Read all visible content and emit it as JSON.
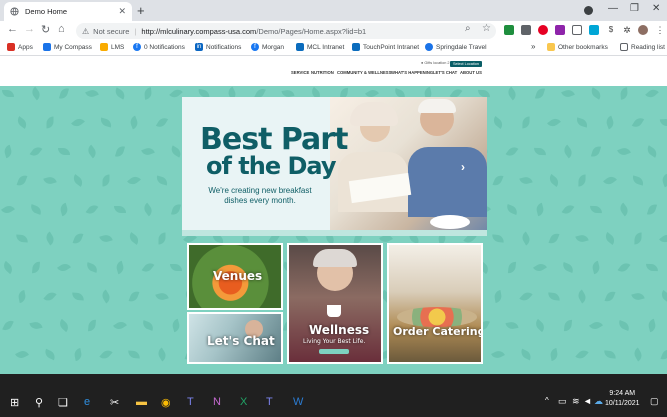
{
  "browser": {
    "tab_title": "Demo Home",
    "new_tab_label": "+",
    "omnibox": {
      "security_label": "Not secure",
      "url_host": "http://mlculinary.compass-usa.com",
      "url_path": "/Demo/Pages/Home.aspx?lid=b1"
    },
    "bookmarks": [
      {
        "label": "Apps",
        "icon": "apps-grid-icon",
        "color": "#d93025"
      },
      {
        "label": "My Compass",
        "icon": "sharepoint-icon",
        "color": "#1a73e8"
      },
      {
        "label": "LMS",
        "icon": "lms-icon",
        "color": "#f9ab00"
      },
      {
        "label": "0 Notifications",
        "icon": "facebook-icon",
        "color": "#1877f2"
      },
      {
        "label": "Notifications",
        "icon": "linkedin-icon",
        "color": "#0a66c2"
      },
      {
        "label": "Morgan",
        "icon": "facebook-icon",
        "color": "#1877f2"
      },
      {
        "label": "MCL Intranet",
        "icon": "sharepoint-icon",
        "color": "#0b6cbd"
      },
      {
        "label": "TouchPoint Intranet",
        "icon": "sharepoint-icon",
        "color": "#0b6cbd"
      },
      {
        "label": "Springdale Travel",
        "icon": "globe-icon",
        "color": "#1a73e8"
      }
    ],
    "more_bookmarks_glyph": "»",
    "other_bookmarks": "Other bookmarks",
    "reading_list": "Reading list"
  },
  "site": {
    "location_text": "Gifts location 2",
    "location_button": "Select Location",
    "nav": [
      "SERVICE",
      "NUTRITION",
      "COMMUNITY & WELLNESS",
      "WHAT'S HAPPENING",
      "LET'S CHAT",
      "ABOUT US"
    ],
    "hero": {
      "title_line1": "Best Part",
      "title_line2": "of the Day",
      "subtitle": "We're creating new breakfast dishes every month."
    },
    "tiles": {
      "venues": "Venues",
      "lets_chat": "Let's Chat",
      "wellness": "Wellness",
      "wellness_sub": "Living Your Best Life.",
      "order_catering": "Order Catering"
    }
  },
  "taskbar": {
    "time": "9:24 AM",
    "date": "10/11/2021"
  },
  "colors": {
    "page_bg": "#7ed1c0",
    "brand_teal": "#0f5e66"
  }
}
